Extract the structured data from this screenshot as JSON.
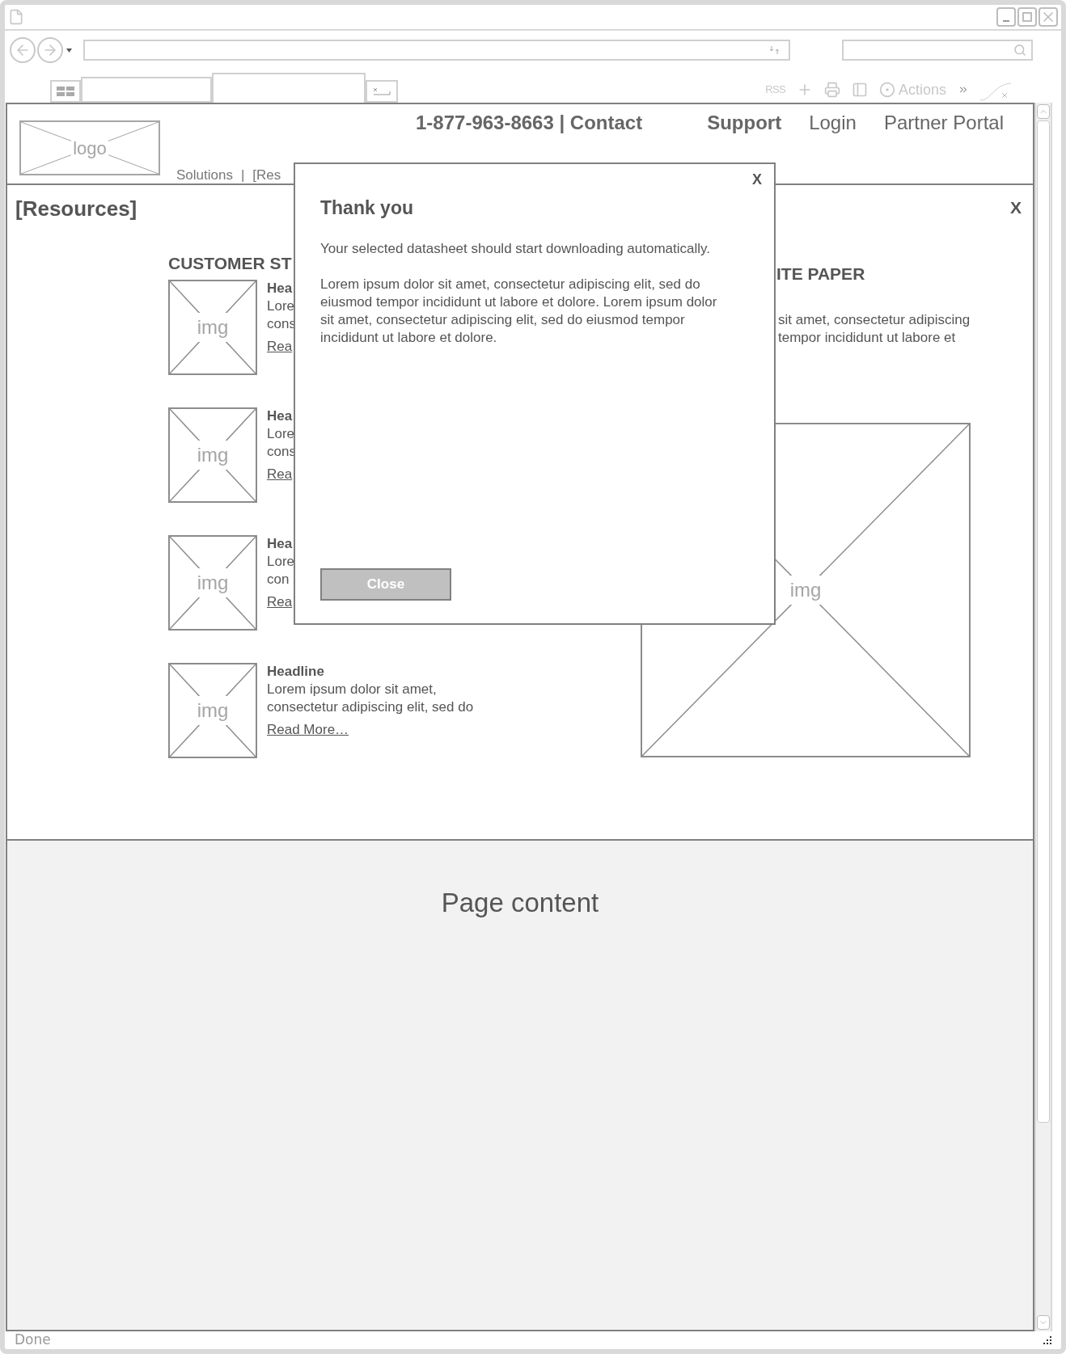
{
  "browser": {
    "toolbar": {
      "rss": "RSS",
      "actions": "Actions"
    },
    "status": "Done"
  },
  "header": {
    "logo": "logo",
    "phone_contact": "1-877-963-8663 | Contact",
    "links": [
      {
        "label": "Support",
        "bold": true
      },
      {
        "label": "Login",
        "bold": false
      },
      {
        "label": "Partner Portal",
        "bold": false
      }
    ],
    "breadcrumb": [
      "Solutions",
      "|",
      "[Res"
    ]
  },
  "section": {
    "title": "[Resources]",
    "close": "X"
  },
  "customer_stories": {
    "heading": "CUSTOMER ST",
    "items": [
      {
        "image_label": "img",
        "headline": "Hea",
        "lines": [
          "Lore",
          "cons"
        ],
        "link": "Rea"
      },
      {
        "image_label": "img",
        "headline": "Hea",
        "lines": [
          "Lore",
          "cons"
        ],
        "link": "Rea"
      },
      {
        "image_label": "img",
        "headline": "Hea",
        "lines": [
          "Lore",
          "con"
        ],
        "link": "Rea"
      },
      {
        "image_label": "img",
        "headline": "Headline",
        "lines": [
          "Lorem ipsum dolor sit amet,",
          "consectetur adipiscing elit, sed do"
        ],
        "link": "Read More…"
      }
    ]
  },
  "white_paper": {
    "heading": "ITE PAPER",
    "lines": [
      "sit amet, consectetur adipiscing",
      "tempor incididunt ut labore et"
    ],
    "image_label": "img"
  },
  "page_content": {
    "text": "Page content"
  },
  "modal": {
    "close": "X",
    "title": "Thank you",
    "message": "Your selected datasheet should start downloading automatically.",
    "body": "Lorem ipsum dolor sit amet, consectetur adipiscing elit, sed do eiusmod tempor incididunt ut labore et dolore. Lorem ipsum dolor sit amet, consectetur adipiscing elit, sed do eiusmod tempor incididunt ut labore et dolore.",
    "button": "Close"
  }
}
